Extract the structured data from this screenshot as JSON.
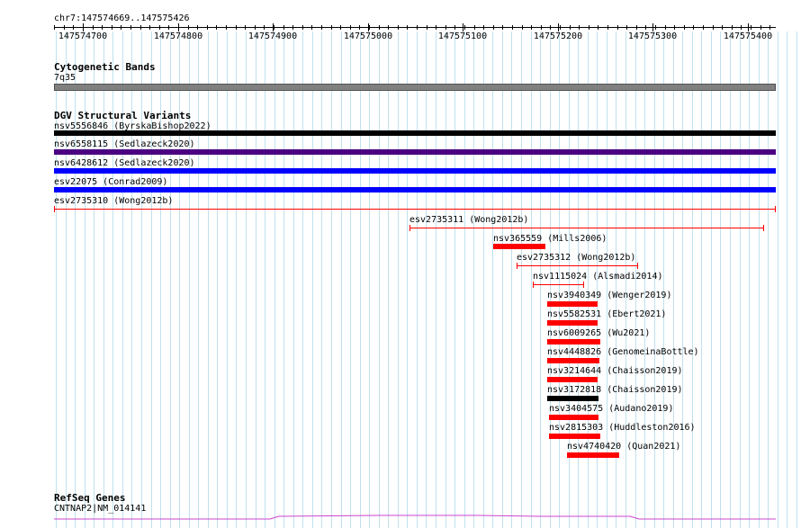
{
  "ruler": {
    "region": "chr7:147574669..147575426",
    "ticks": [
      "147574700",
      "147574800",
      "147574900",
      "147575000",
      "147575100",
      "147575200",
      "147575300",
      "147575400"
    ]
  },
  "cytoband": {
    "title": "Cytogenetic Bands",
    "band_label": "7q35",
    "band_color": "#808080"
  },
  "dgv": {
    "title": "DGV Structural Variants",
    "features": [
      {
        "label": "nsv5556846 (ByrskaBishop2022)",
        "color": "#000000",
        "style": "thick"
      },
      {
        "label": "nsv6558115 (Sedlazeck2020)",
        "color": "#4b0082",
        "style": "thick"
      },
      {
        "label": "nsv6428612 (Sedlazeck2020)",
        "color": "#0000ff",
        "style": "thick"
      },
      {
        "label": "esv22075 (Conrad2009)",
        "color": "#0000ff",
        "style": "thick"
      },
      {
        "label": "esv2735310 (Wong2012b)",
        "color": "#ff0000",
        "style": "thin"
      },
      {
        "label": "esv2735311 (Wong2012b)",
        "color": "#ff0000",
        "style": "thin"
      },
      {
        "label": "nsv365559 (Mills2006)",
        "color": "#ff0000",
        "style": "thick"
      },
      {
        "label": "esv2735312 (Wong2012b)",
        "color": "#ff0000",
        "style": "thin"
      },
      {
        "label": "nsv1115024 (Alsmadi2014)",
        "color": "#ff0000",
        "style": "thin"
      },
      {
        "label": "nsv3940349 (Wenger2019)",
        "color": "#ff0000",
        "style": "thick"
      },
      {
        "label": "nsv5582531 (Ebert2021)",
        "color": "#ff0000",
        "style": "thick"
      },
      {
        "label": "nsv6009265 (Wu2021)",
        "color": "#ff0000",
        "style": "thick"
      },
      {
        "label": "nsv4448826 (GenomeinaBottle)",
        "color": "#ff0000",
        "style": "thick"
      },
      {
        "label": "nsv3214644 (Chaisson2019)",
        "color": "#ff0000",
        "style": "thick"
      },
      {
        "label": "nsv3172818 (Chaisson2019)",
        "color": "#000000",
        "style": "thick"
      },
      {
        "label": "nsv3404575 (Audano2019)",
        "color": "#ff0000",
        "style": "thick"
      },
      {
        "label": "nsv2815303 (Huddleston2016)",
        "color": "#ff0000",
        "style": "thick"
      },
      {
        "label": "nsv4740420 (Quan2021)",
        "color": "#ff0000",
        "style": "thick"
      }
    ]
  },
  "refseq": {
    "title": "RefSeq Genes",
    "gene_label": "CNTNAP2|NM_014141",
    "gene_color": "#cc44cc"
  }
}
